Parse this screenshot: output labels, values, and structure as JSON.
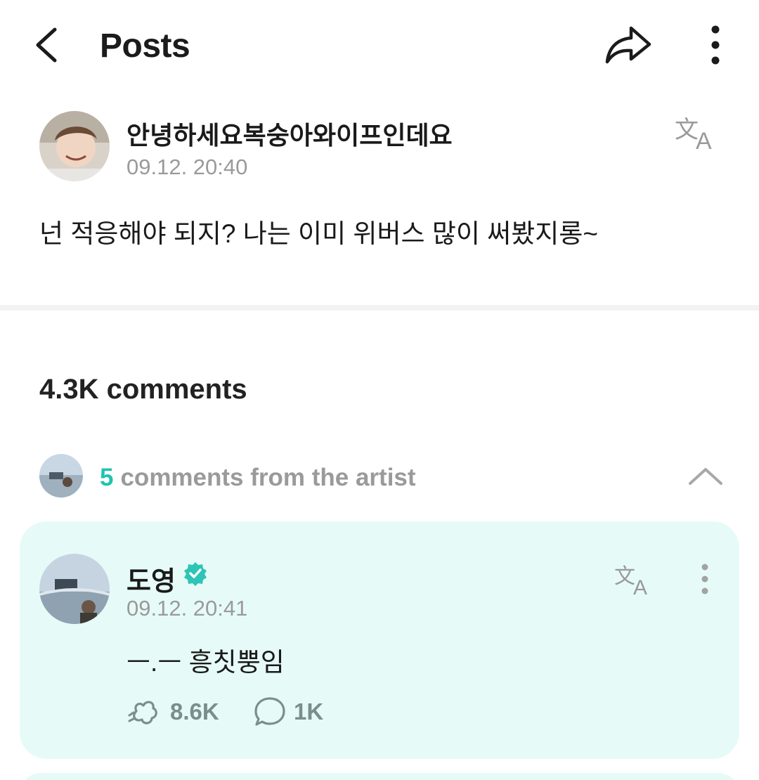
{
  "header": {
    "title": "Posts",
    "back_icon": "chevron-left-icon",
    "share_icon": "share-icon",
    "more_icon": "more-vertical-icon"
  },
  "post": {
    "author": "안녕하세요복숭아와이프인데요",
    "time": "09.12. 20:40",
    "body": "넌 적응해야 되지? 나는 이미 위버스 많이 써봤지롱~",
    "translate_icon": "translate-icon"
  },
  "comments": {
    "count_label": "4.3K comments"
  },
  "artist_section": {
    "count": "5",
    "label": "comments from the artist",
    "collapse_icon": "chevron-up-icon"
  },
  "artist_comment": {
    "name": "도영",
    "verified_icon": "verified-badge-icon",
    "time": "09.12. 20:41",
    "text": "ㅡ.ㅡ 흥칫뿡임",
    "likes": "8.6K",
    "replies": "1K"
  },
  "colors": {
    "accent": "#20c3b3",
    "card_bg": "#e6fbf7",
    "muted_text": "#9a9a9a"
  }
}
